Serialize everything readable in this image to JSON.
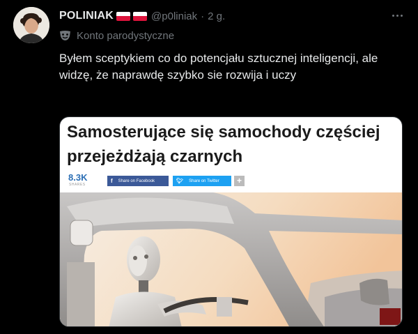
{
  "post": {
    "display_name": "POLINIAK",
    "handle": "@p0liniak",
    "separator": "·",
    "time": "2 g.",
    "label": "Konto parodystyczne",
    "text": "Byłem sceptykiem co do potencjału sztucznej inteligencji, ale widzę, że naprawdę szybko sie rozwija i uczy"
  },
  "media": {
    "headline": "Samosterujące się samochody częściej przejeżdżają czarnych",
    "shares_count": "8.3K",
    "shares_label": "SHARES",
    "facebook_label": "Share on Facebook",
    "twitter_label": "Share on Twitter",
    "plus_label": "+"
  },
  "icons": {
    "more": "more-options-icon",
    "parody": "theater-mask-icon",
    "flag": "poland-flag-icon"
  },
  "colors": {
    "background": "#000000",
    "text": "#e7e9ea",
    "muted": "#71767b",
    "facebook": "#3b5998",
    "twitter": "#1da1f2",
    "shares": "#2c6fb5"
  }
}
